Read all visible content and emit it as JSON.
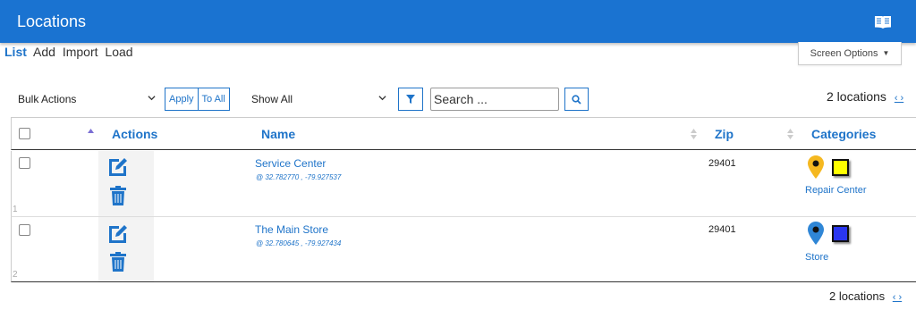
{
  "header": {
    "title": "Locations",
    "book_icon": "book-icon"
  },
  "subnav": {
    "list": "List",
    "add": "Add",
    "import": "Import",
    "load": "Load"
  },
  "screen_options": {
    "label": "Screen Options",
    "caret": "▼"
  },
  "toolbar": {
    "bulk_actions": "Bulk Actions",
    "apply": "Apply",
    "to_all": "To All",
    "filter_select": "Show All",
    "search_placeholder": "Search ...",
    "count": "2 locations",
    "pager": "‹ ›"
  },
  "table": {
    "columns": {
      "actions": "Actions",
      "name": "Name",
      "zip": "Zip",
      "categories": "Categories"
    },
    "rows": [
      {
        "num": "1",
        "name": "Service Center",
        "coords": "@ 32.782770 , -79.927537",
        "zip": "29401",
        "category": "Repair Center",
        "pin_color": "#f5b820",
        "swatch_color": "#ffff00"
      },
      {
        "num": "2",
        "name": "The Main Store",
        "coords": "@ 32.780645 , -79.927434",
        "zip": "29401",
        "category": "Store",
        "pin_color": "#2f86d6",
        "swatch_color": "#2a36f0"
      }
    ]
  },
  "footer": {
    "count": "2 locations",
    "pager": "‹ ›"
  },
  "colors": {
    "topbar": "#1a73d1",
    "link": "#1f74c9"
  }
}
